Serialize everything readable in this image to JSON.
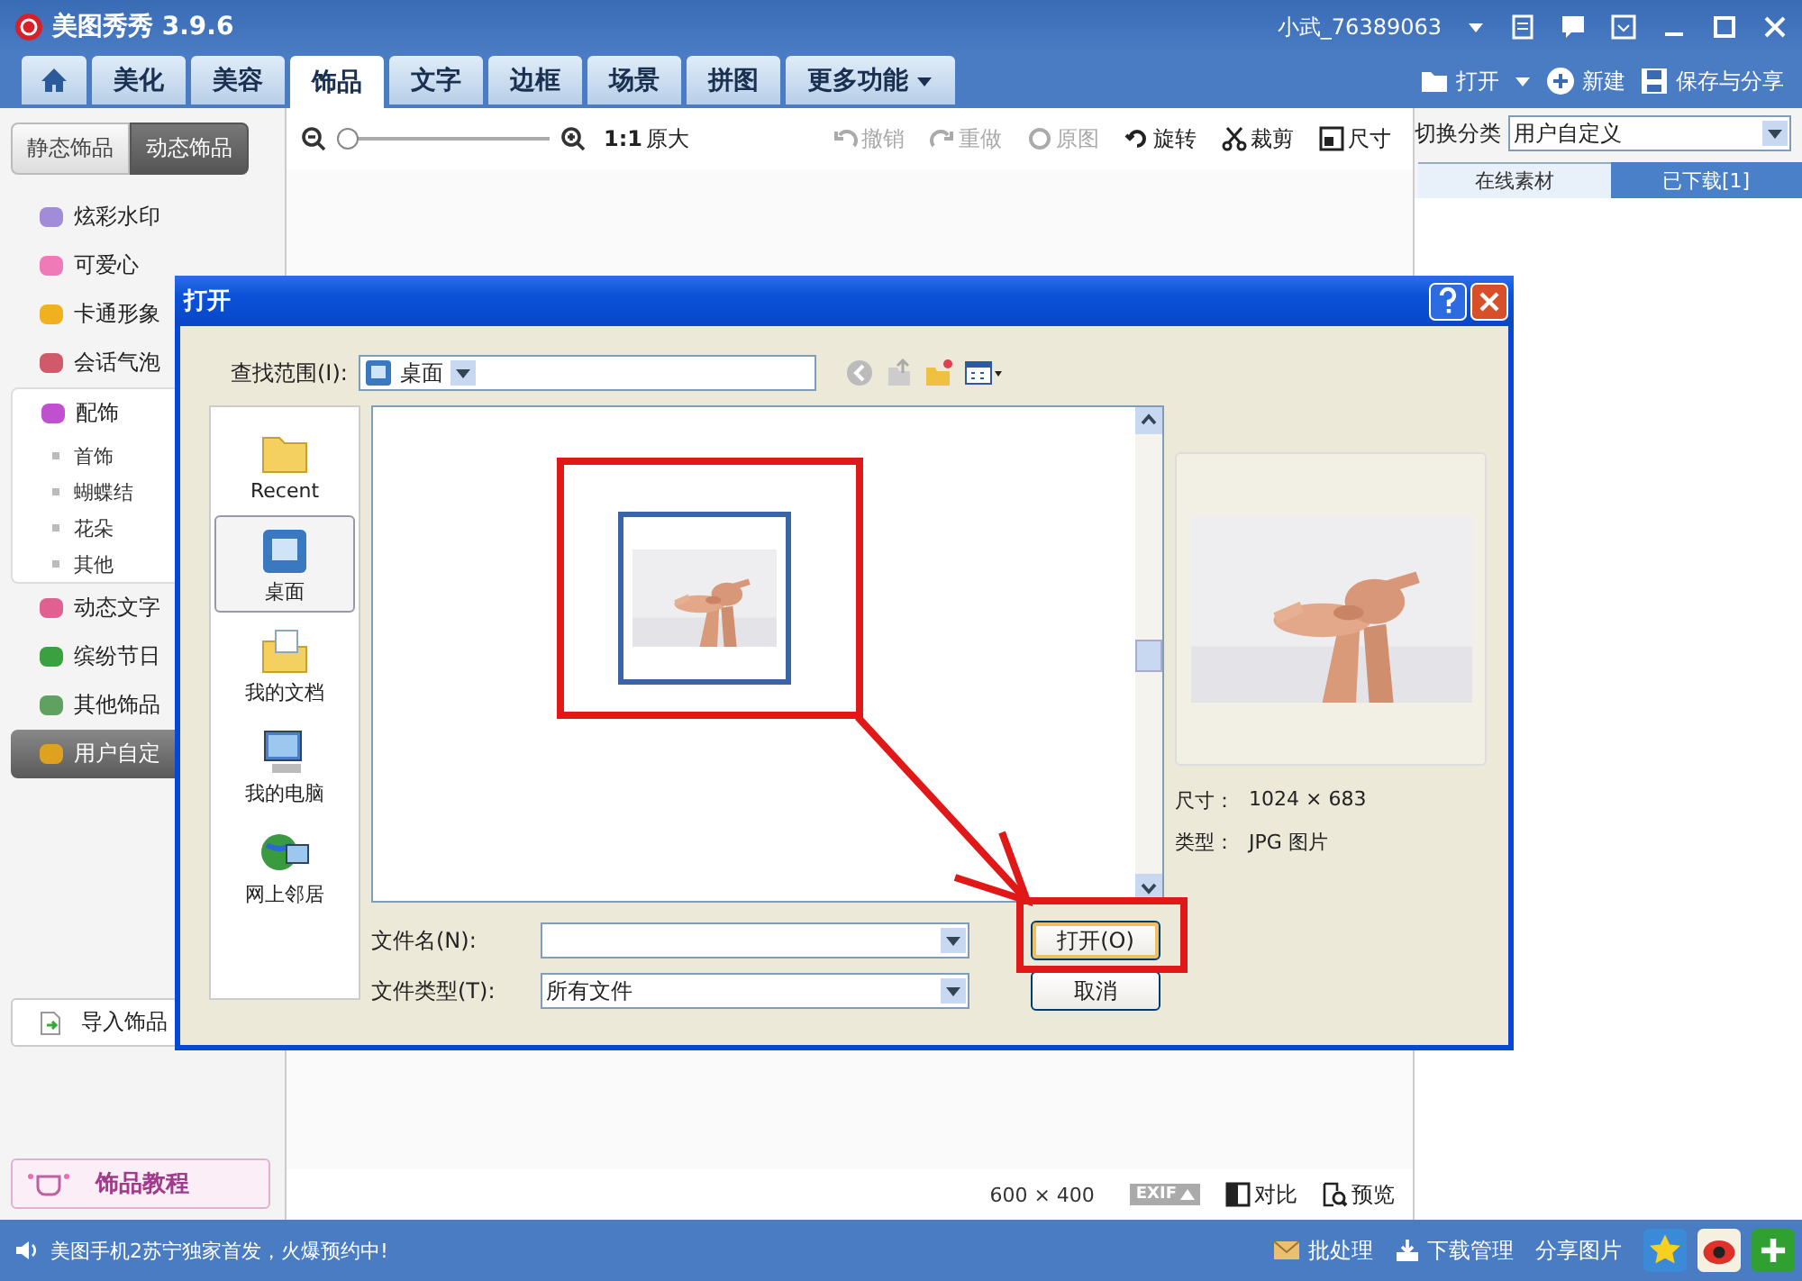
{
  "window": {
    "app_name": "美图秀秀 3.9.6",
    "user": "小武_76389063"
  },
  "tabs": [
    {
      "kind": "home",
      "selected": false
    },
    {
      "kind": "text",
      "label": "美化",
      "selected": false
    },
    {
      "kind": "text",
      "label": "美容",
      "selected": false
    },
    {
      "kind": "text",
      "label": "饰品",
      "selected": true
    },
    {
      "kind": "text",
      "label": "文字",
      "selected": false
    },
    {
      "kind": "text",
      "label": "边框",
      "selected": false
    },
    {
      "kind": "text",
      "label": "场景",
      "selected": false
    },
    {
      "kind": "text",
      "label": "拼图",
      "selected": false
    },
    {
      "kind": "menu",
      "label": "更多功能",
      "selected": false
    }
  ],
  "file_actions": [
    {
      "kind": "open",
      "label": "打开"
    },
    {
      "kind": "new",
      "label": "新建"
    },
    {
      "kind": "save",
      "label": "保存与分享"
    }
  ],
  "mode_switch": [
    {
      "label": "静态饰品",
      "selected": false
    },
    {
      "label": "动态饰品",
      "selected": true
    }
  ],
  "zoom": {
    "level": 0,
    "ratio": "1:1",
    "ratio_label": "原大"
  },
  "edit_tools": [
    {
      "kind": "undo",
      "label": "撤销",
      "disabled": true
    },
    {
      "kind": "redo",
      "label": "重做",
      "disabled": true
    },
    {
      "kind": "original",
      "label": "原图",
      "disabled": true
    },
    {
      "kind": "rotate",
      "label": "旋转",
      "disabled": false
    },
    {
      "kind": "crop",
      "label": "裁剪",
      "disabled": false
    },
    {
      "kind": "resize",
      "label": "尺寸",
      "disabled": false
    }
  ],
  "category": {
    "label": "切换分类",
    "value": "用户自定义"
  },
  "material_tabs": [
    {
      "label": "在线素材",
      "selected": true
    },
    {
      "label": "已下载[1]",
      "selected": false
    }
  ],
  "sidebar": {
    "items": [
      {
        "kind": "sparkle",
        "label": "炫彩水印",
        "selected": false
      },
      {
        "kind": "heart",
        "label": "可爱心",
        "selected": false
      },
      {
        "kind": "cartoon",
        "label": "卡通形象",
        "selected": false
      },
      {
        "kind": "bubble",
        "label": "会话气泡",
        "selected": false
      },
      {
        "kind": "bow",
        "label": "配饰",
        "selected": false,
        "expanded": true,
        "children": [
          {
            "label": "首饰"
          },
          {
            "label": "蝴蝶结"
          },
          {
            "label": "花朵"
          },
          {
            "label": "其他"
          }
        ]
      },
      {
        "kind": "text",
        "label": "动态文字",
        "selected": false
      },
      {
        "kind": "gift",
        "label": "缤纷节日",
        "selected": false
      },
      {
        "kind": "star",
        "label": "其他饰品",
        "selected": false
      },
      {
        "kind": "folder",
        "label": "用户自定",
        "selected": true
      }
    ],
    "import_button": "导入饰品",
    "tutorial_button": "饰品教程"
  },
  "image_info": {
    "size": "600 × 400",
    "exif": "EXIF"
  },
  "view_tools": [
    {
      "kind": "compare",
      "label": "对比"
    },
    {
      "kind": "preview",
      "label": "预览"
    }
  ],
  "status_bar": {
    "message": "美图手机2苏宁独家首发，火爆预约中!",
    "actions": [
      {
        "kind": "batch",
        "label": "批处理"
      },
      {
        "kind": "download",
        "label": "下载管理"
      },
      {
        "kind": "share",
        "label": "分享图片"
      }
    ]
  },
  "dialog": {
    "title": "打开",
    "look_in_label": "查找范围(I):",
    "look_in_value": "桌面",
    "places": [
      {
        "kind": "recent",
        "label": "Recent",
        "selected": false
      },
      {
        "kind": "desktop",
        "label": "桌面",
        "selected": true
      },
      {
        "kind": "documents",
        "label": "我的文档",
        "selected": false
      },
      {
        "kind": "computer",
        "label": "我的电脑",
        "selected": false
      },
      {
        "kind": "network",
        "label": "网上邻居",
        "selected": false
      }
    ],
    "files": [
      {
        "kind": "picture",
        "selected": true
      }
    ],
    "preview": {
      "kind": "picture",
      "size_label": "尺寸：",
      "size_value": "1024 × 683",
      "type_label": "类型：",
      "type_value": "JPG 图片"
    },
    "filename_label": "文件名(N):",
    "filetype_label": "文件类型(T):",
    "filetype_value": "所有文件",
    "buttons": [
      {
        "kind": "default",
        "label": "打开(O)"
      },
      {
        "kind": "normal",
        "label": "取消"
      }
    ]
  }
}
